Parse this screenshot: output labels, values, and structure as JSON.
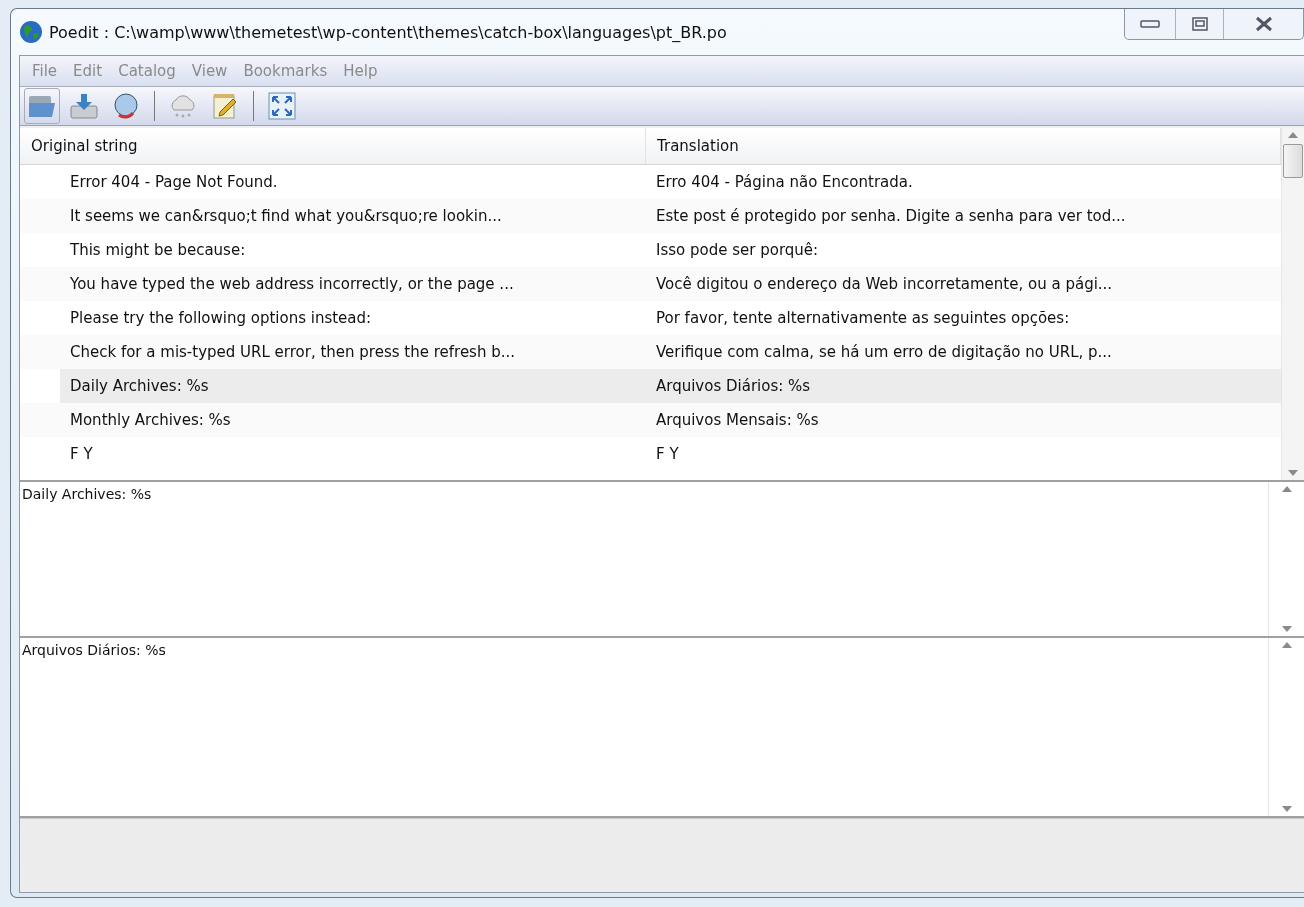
{
  "window": {
    "title": "Poedit : C:\\wamp\\www\\themetest\\wp-content\\themes\\catch-box\\languages\\pt_BR.po"
  },
  "menu": [
    "File",
    "Edit",
    "Catalog",
    "View",
    "Bookmarks",
    "Help"
  ],
  "table": {
    "columns": [
      "Original string",
      "Translation"
    ],
    "rows": [
      {
        "original": "Error 404 - Page Not Found.",
        "translation": "Erro 404 - Página não Encontrada.",
        "selected": false
      },
      {
        "original": "It seems we can&rsquo;t find what you&rsquo;re lookin...",
        "translation": "Este post é protegido por senha. Digite a senha para ver tod...",
        "selected": false
      },
      {
        "original": "This might be because:",
        "translation": "Isso pode ser porquê:",
        "selected": false
      },
      {
        "original": "You have typed the web address incorrectly, or the page ...",
        "translation": "Você digitou o endereço da Web incorretamente, ou a pági...",
        "selected": false
      },
      {
        "original": "Please try the following options instead:",
        "translation": "Por favor, tente alternativamente as seguintes opções:",
        "selected": false
      },
      {
        "original": "Check for a mis-typed URL error, then press the refresh b...",
        "translation": "Verifique com calma, se há um erro de digitação no URL, p...",
        "selected": false
      },
      {
        "original": "Daily Archives: %s",
        "translation": "Arquivos Diários: %s",
        "selected": true
      },
      {
        "original": "Monthly Archives: %s",
        "translation": "Arquivos Mensais: %s",
        "selected": false
      },
      {
        "original": "F Y",
        "translation": "F Y",
        "selected": false
      }
    ]
  },
  "source_text": "Daily Archives: %s",
  "translation_text": "Arquivos Diários: %s"
}
